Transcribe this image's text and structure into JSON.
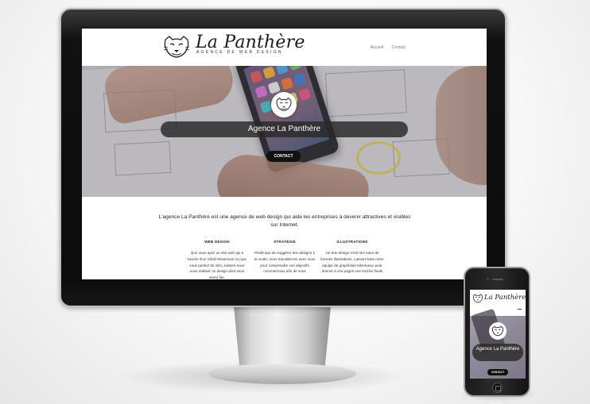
{
  "website": {
    "brand_name": "La Panthère",
    "tagline": "Agence de web design",
    "nav": [
      "Accueil",
      "Contact"
    ],
    "hero": {
      "title": "Agence La Panthère",
      "cta_label": "CONTACT"
    },
    "intro": "L'agence La Panthère est une agence de web design qui aide les entreprises à devenir attractives et visibles sur Internet.",
    "columns": [
      {
        "title": "WEB DESIGN",
        "text": "Que vous ayez un site web qui a besoin d'un rafraîchissement ou que vous partiez de zéro, laissez-nous vous réaliser un design dont vous serez fier."
      },
      {
        "title": "STRATÉGIE",
        "text": "Plutôt que de suggérer des designs à la mode, nous travaillerons avec vous pour comprendre vos objectifs commerciaux afin de vous"
      },
      {
        "title": "ILLUSTRATIONS",
        "text": "Un bon design n'est rien sans de bonnes illustrations. Laissez faire notre équipe de graphistes talentueux pour donner à vos pages une touche finale"
      }
    ]
  },
  "mobile": {
    "brand_name": "La Panthère",
    "hero_title": "Agence La Panthère",
    "cta_label": "CONTACT"
  },
  "icons": {
    "logo": "panther-head-icon",
    "menu": "hamburger-menu-icon",
    "home_button": "home-button-icon"
  },
  "colors": {
    "hero_bar": "#2a2a2a",
    "cta": "#111111",
    "device_bezel": "#0b0b0b"
  }
}
